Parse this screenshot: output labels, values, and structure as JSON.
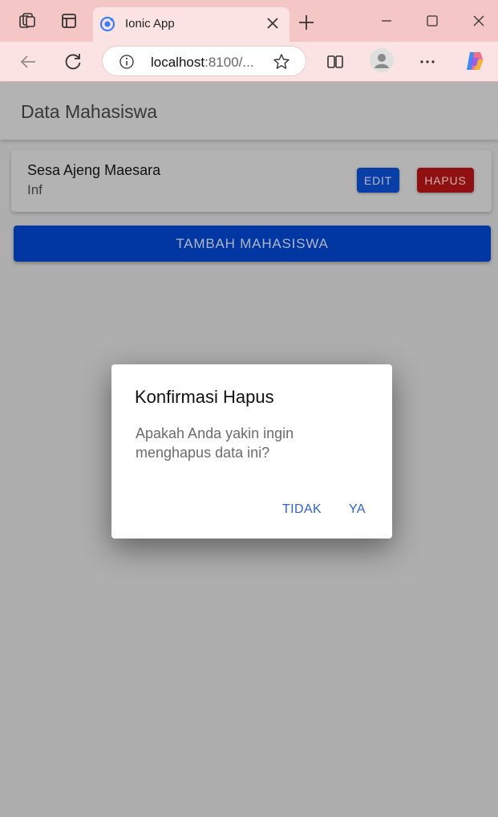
{
  "browser": {
    "tab_title": "Ionic App",
    "url_host": "localhost",
    "url_rest": ":8100/..."
  },
  "app": {
    "title": "Data Mahasiswa",
    "students": [
      {
        "name": "Sesa Ajeng Maesara",
        "major": "Inf"
      }
    ],
    "edit_label": "EDIT",
    "delete_label": "HAPUS",
    "add_label": "TAMBAH MAHASISWA"
  },
  "dialog": {
    "title": "Konfirmasi Hapus",
    "message": "Apakah Anda yakin ingin menghapus data ini?",
    "cancel_label": "TIDAK",
    "confirm_label": "YA"
  },
  "colors": {
    "accent": "#0037a3",
    "danger": "#8f1010",
    "dialog_button": "#2d62d6",
    "browser_tint": "#f4c6c6"
  },
  "icons": [
    "tab-actions-icon",
    "workspaces-icon",
    "favicon-icon",
    "close-icon",
    "plus-icon",
    "minimize-icon",
    "maximize-icon",
    "window-close-icon",
    "back-icon",
    "refresh-icon",
    "info-icon",
    "star-icon",
    "split-screen-icon",
    "profile-icon",
    "more-icon",
    "copilot-icon"
  ]
}
